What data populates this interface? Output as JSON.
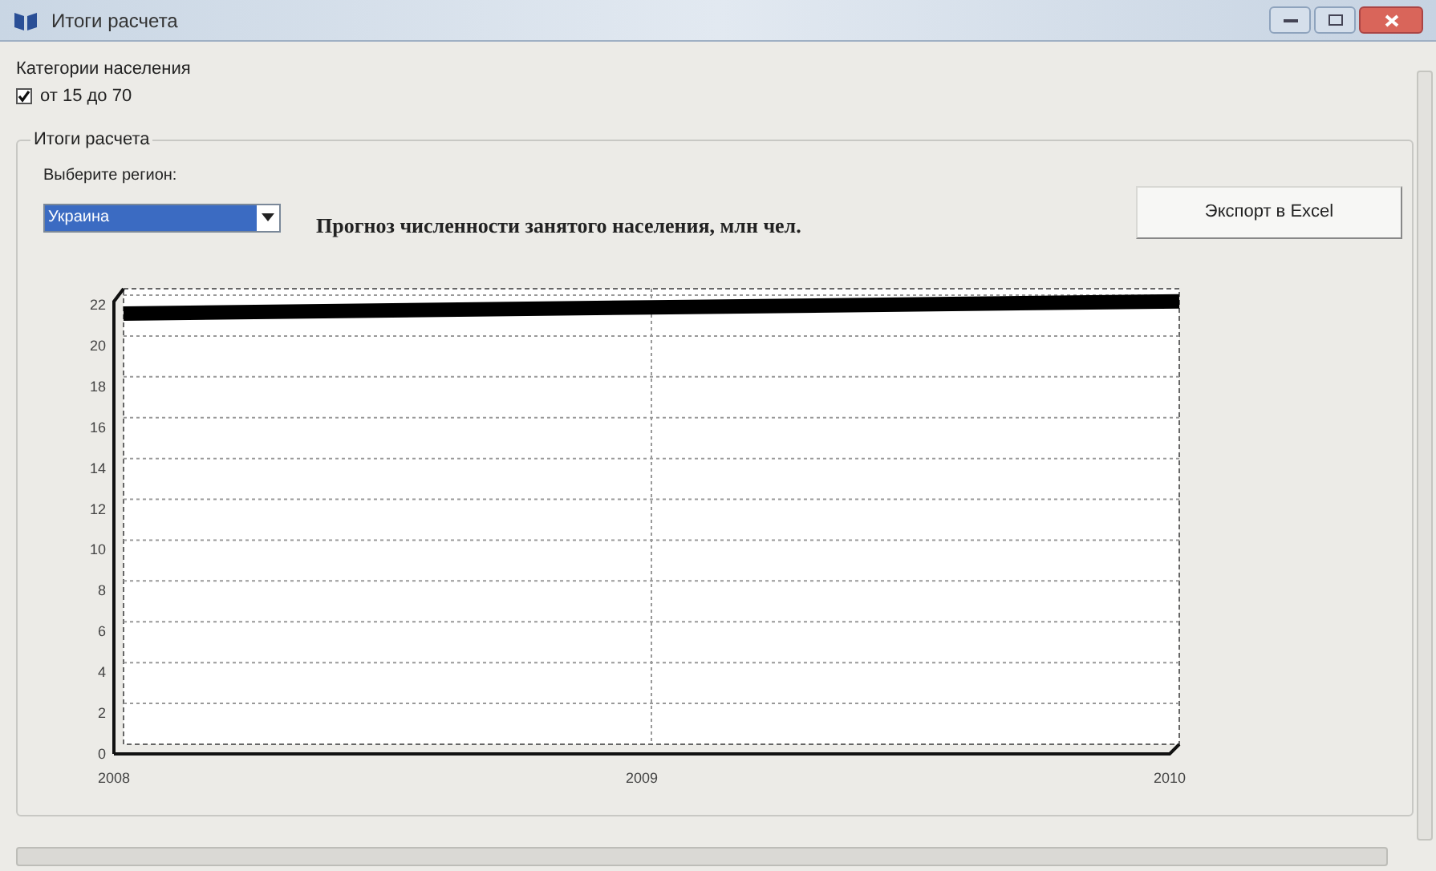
{
  "window": {
    "title": "Итоги расчета"
  },
  "population_categories": {
    "label": "Категории населения",
    "items": [
      {
        "label": "от 15 до 70",
        "checked": true
      }
    ]
  },
  "results_group": {
    "title": "Итоги расчета",
    "region_label": "Выберите регион:",
    "region_value": "Украина",
    "chart_title": "Прогноз численности занятого населения, млн чел.",
    "export_button": "Экспорт в Excel",
    "chart_data": {
      "type": "line",
      "categories": [
        "2008",
        "2009",
        "2010"
      ],
      "series": [
        {
          "color": "#000000",
          "values": [
            21.1,
            21.4,
            21.7
          ]
        }
      ],
      "grid": true,
      "ylim": [
        0,
        22
      ],
      "yticks": [
        0,
        2,
        4,
        6,
        8,
        10,
        12,
        14,
        16,
        18,
        20,
        22
      ]
    }
  }
}
